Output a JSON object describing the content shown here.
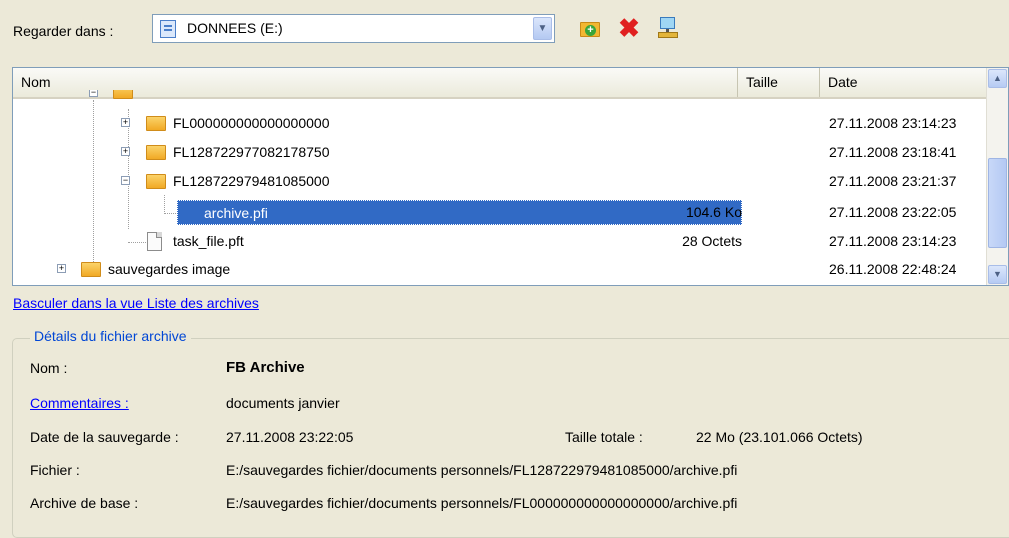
{
  "toolbar": {
    "look_in_label": "Regarder dans :",
    "drive_value": "DONNEES (E:)",
    "icons": [
      "folder-add-icon",
      "delete-icon",
      "network-drive-icon"
    ]
  },
  "list": {
    "columns": {
      "name": "Nom",
      "size": "Taille",
      "date": "Date"
    },
    "rows": [
      {
        "name": "FL000000000000000000",
        "size": "",
        "date": "27.11.2008 23:14:23",
        "type": "folder"
      },
      {
        "name": "FL128722977082178750",
        "size": "",
        "date": "27.11.2008 23:18:41",
        "type": "folder"
      },
      {
        "name": "FL128722979481085000",
        "size": "",
        "date": "27.11.2008 23:21:37",
        "type": "folder"
      },
      {
        "name": "archive.pfi",
        "size": "104.6 Ko",
        "date": "27.11.2008 23:22:05",
        "type": "file",
        "selected": true
      },
      {
        "name": "task_file.pft",
        "size": "28 Octets",
        "date": "27.11.2008 23:14:23",
        "type": "file"
      },
      {
        "name": "sauvegardes image",
        "size": "",
        "date": "26.11.2008 22:48:24",
        "type": "folder"
      }
    ]
  },
  "switch_link": "Basculer dans la vue Liste des archives",
  "details": {
    "legend": "Détails du fichier archive",
    "name_label": "Nom :",
    "name_value": "FB Archive",
    "comments_label": "Commentaires :",
    "comments_value": "documents janvier",
    "backup_date_label": "Date de la sauvegarde :",
    "backup_date_value": "27.11.2008 23:22:05",
    "total_size_label": "Taille totale :",
    "total_size_value": "22 Mo (23.101.066 Octets)",
    "file_label": "Fichier :",
    "file_value": "E:/sauvegardes fichier/documents personnels/FL128722979481085000/archive.pfi",
    "base_archive_label": "Archive de base :",
    "base_archive_value": "E:/sauvegardes fichier/documents personnels/FL000000000000000000/archive.pfi"
  },
  "colors": {
    "selection": "#316ac5",
    "link": "#0000ff",
    "legend": "#0046d5",
    "background": "#ece9d8"
  }
}
